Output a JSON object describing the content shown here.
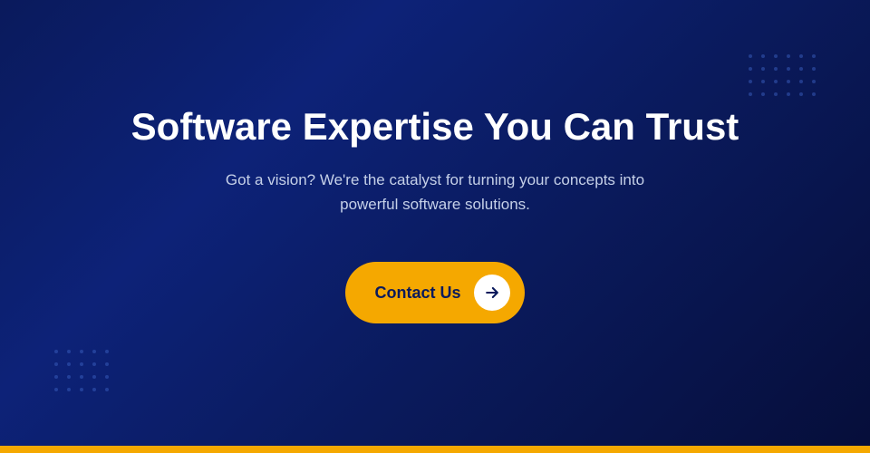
{
  "hero": {
    "title": "Software Expertise You Can Trust",
    "subtitle": "Got a vision? We're the catalyst for turning your concepts into powerful software solutions.",
    "cta_label": "Contact Us",
    "bg_color": "#0a1a5c",
    "accent_color": "#f5a800",
    "text_color": "#ffffff",
    "subtitle_color": "#c5d0e8"
  },
  "gold_bar": {
    "color": "#f5a800"
  },
  "dots": {
    "top_right_rows": 4,
    "top_right_cols": 6,
    "bottom_left_rows": 4,
    "bottom_left_cols": 5
  }
}
